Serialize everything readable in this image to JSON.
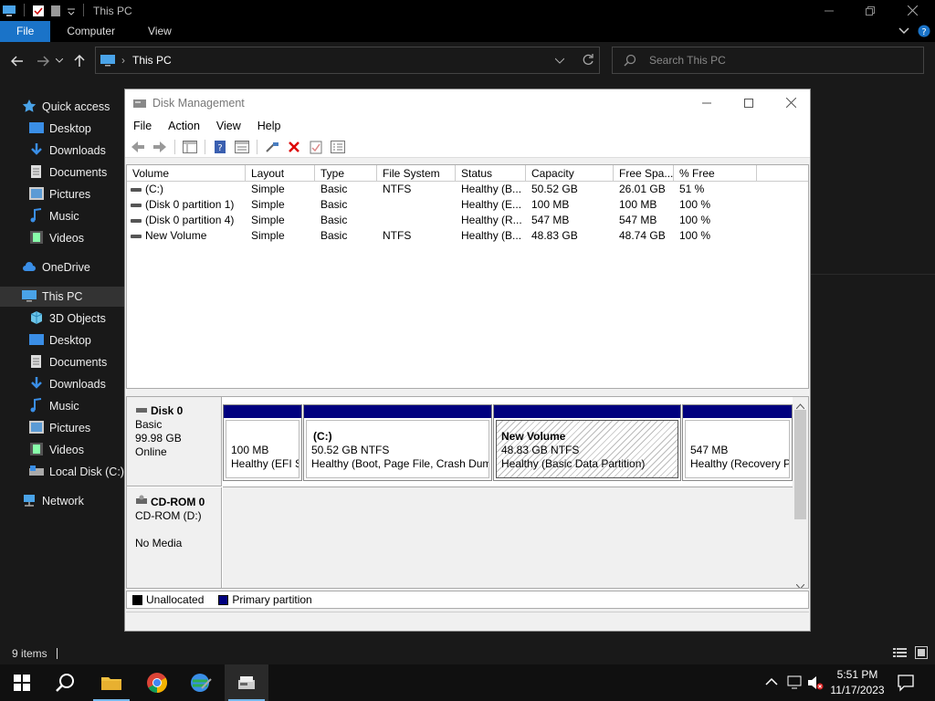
{
  "explorer": {
    "title": "This PC",
    "ribbon_tabs": [
      "File",
      "Computer",
      "View"
    ],
    "address": "This PC",
    "search_placeholder": "Search This PC",
    "status": "9 items",
    "nav": {
      "quick_access": "Quick access",
      "qa_items": [
        "Desktop",
        "Downloads",
        "Documents",
        "Pictures",
        "Music",
        "Videos"
      ],
      "onedrive": "OneDrive",
      "this_pc": "This PC",
      "pc_items": [
        "3D Objects",
        "Desktop",
        "Documents",
        "Downloads",
        "Music",
        "Pictures",
        "Videos",
        "Local Disk (C:)"
      ],
      "network": "Network"
    }
  },
  "disk_mgmt": {
    "title": "Disk Management",
    "menu": [
      "File",
      "Action",
      "View",
      "Help"
    ],
    "columns": [
      "Volume",
      "Layout",
      "Type",
      "File System",
      "Status",
      "Capacity",
      "Free Spa...",
      "% Free"
    ],
    "rows": [
      [
        "(C:)",
        "Simple",
        "Basic",
        "NTFS",
        "Healthy (B...",
        "50.52 GB",
        "26.01 GB",
        "51 %"
      ],
      [
        "(Disk 0 partition 1)",
        "Simple",
        "Basic",
        "",
        "Healthy (E...",
        "100 MB",
        "100 MB",
        "100 %"
      ],
      [
        "(Disk 0 partition 4)",
        "Simple",
        "Basic",
        "",
        "Healthy (R...",
        "547 MB",
        "547 MB",
        "100 %"
      ],
      [
        "New Volume",
        "Simple",
        "Basic",
        "NTFS",
        "Healthy (B...",
        "48.83 GB",
        "48.74 GB",
        "100 %"
      ]
    ],
    "disk0": {
      "name": "Disk 0",
      "type": "Basic",
      "size": "99.98 GB",
      "state": "Online",
      "partitions": [
        {
          "name": "",
          "line1": "100 MB",
          "line2": "Healthy (EFI S"
        },
        {
          "name": "(C:)",
          "line1": "50.52 GB NTFS",
          "line2": "Healthy (Boot, Page File, Crash Dum"
        },
        {
          "name": "New Volume",
          "line1": "48.83 GB NTFS",
          "line2": "Healthy (Basic Data Partition)"
        },
        {
          "name": "",
          "line1": "547 MB",
          "line2": "Healthy (Recovery P"
        }
      ]
    },
    "cdrom": {
      "name": "CD-ROM 0",
      "drive": "CD-ROM (D:)",
      "media": "No Media"
    },
    "legend": [
      "Unallocated",
      "Primary partition"
    ]
  },
  "taskbar": {
    "time": "5:51 PM",
    "date": "11/17/2023"
  },
  "colors": {
    "primary_partition": "#00007f",
    "accent": "#1a73c8"
  }
}
